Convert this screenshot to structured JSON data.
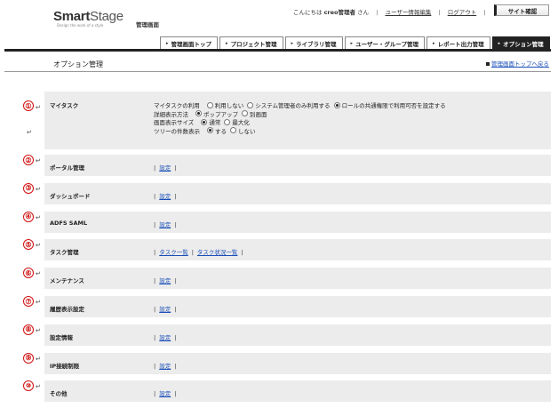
{
  "header": {
    "logo_main": "Smart",
    "logo_main_lite": "Stage",
    "logo_sub": "Design the work of a style",
    "admin_label": "管理画面",
    "greeting_prefix": "こんにちは",
    "greeting_user": "creo管理者",
    "greeting_suffix": "さん",
    "user_info_link": "ユーザー情報編集",
    "logout_link": "ログアウト",
    "site_button": "サイト確認"
  },
  "tabs": [
    {
      "label": "管理画面トップ",
      "active": false
    },
    {
      "label": "プロジェクト管理",
      "active": false
    },
    {
      "label": "ライブラリ管理",
      "active": false
    },
    {
      "label": "ユーザー・グループ管理",
      "active": false
    },
    {
      "label": "レポート出力管理",
      "active": false
    },
    {
      "label": "オプション管理",
      "active": true
    }
  ],
  "page": {
    "title": "オプション管理",
    "back_link": "管理画面トップへ戻る"
  },
  "mytask": {
    "number": "①",
    "label": "マイタスク",
    "rows": [
      {
        "label": "マイタスクの利用",
        "options": [
          {
            "text": "利用しない",
            "selected": false
          },
          {
            "text": "システム管理者のみ利用する",
            "selected": false
          },
          {
            "text": "ロールの共通権限で利用可否を設定する",
            "selected": true
          }
        ]
      },
      {
        "label": "詳細表示方法",
        "options": [
          {
            "text": "ポップアップ",
            "selected": true
          },
          {
            "text": "別画面",
            "selected": false
          }
        ]
      },
      {
        "label": "画面表示サイズ",
        "options": [
          {
            "text": "通常",
            "selected": true
          },
          {
            "text": "最大化",
            "selected": false
          }
        ]
      },
      {
        "label": "ツリーの件数表示",
        "options": [
          {
            "text": "する",
            "selected": true
          },
          {
            "text": "しない",
            "selected": false
          }
        ]
      }
    ]
  },
  "sections": [
    {
      "number": "②",
      "label": "ポータル管理",
      "links": [
        "設定"
      ]
    },
    {
      "number": "③",
      "label": "ダッシュボード",
      "links": [
        "設定"
      ]
    },
    {
      "number": "④",
      "label": "ADFS SAML",
      "links": [
        "設定"
      ]
    },
    {
      "number": "⑤",
      "label": "タスク管理",
      "links": [
        "タスク一覧",
        "タスク状況一覧"
      ]
    },
    {
      "number": "⑥",
      "label": "メンテナンス",
      "links": [
        "設定"
      ]
    },
    {
      "number": "⑦",
      "label": "履歴表示設定",
      "links": [
        "設定"
      ]
    },
    {
      "number": "⑧",
      "label": "設定情報",
      "links": [
        "設定"
      ]
    },
    {
      "number": "⑨",
      "label": "IP接続制限",
      "links": [
        "設定"
      ]
    },
    {
      "number": "⑩",
      "label": "その他",
      "links": [
        "設定"
      ]
    }
  ],
  "colors": {
    "annotation_red": "#d01010",
    "link_blue": "#1a4fb8",
    "section_bg": "#ececec",
    "active_tab": "#222222"
  },
  "glyphs": {
    "return_mark": "↵",
    "tab_arrow": "▸",
    "separator": "|"
  }
}
